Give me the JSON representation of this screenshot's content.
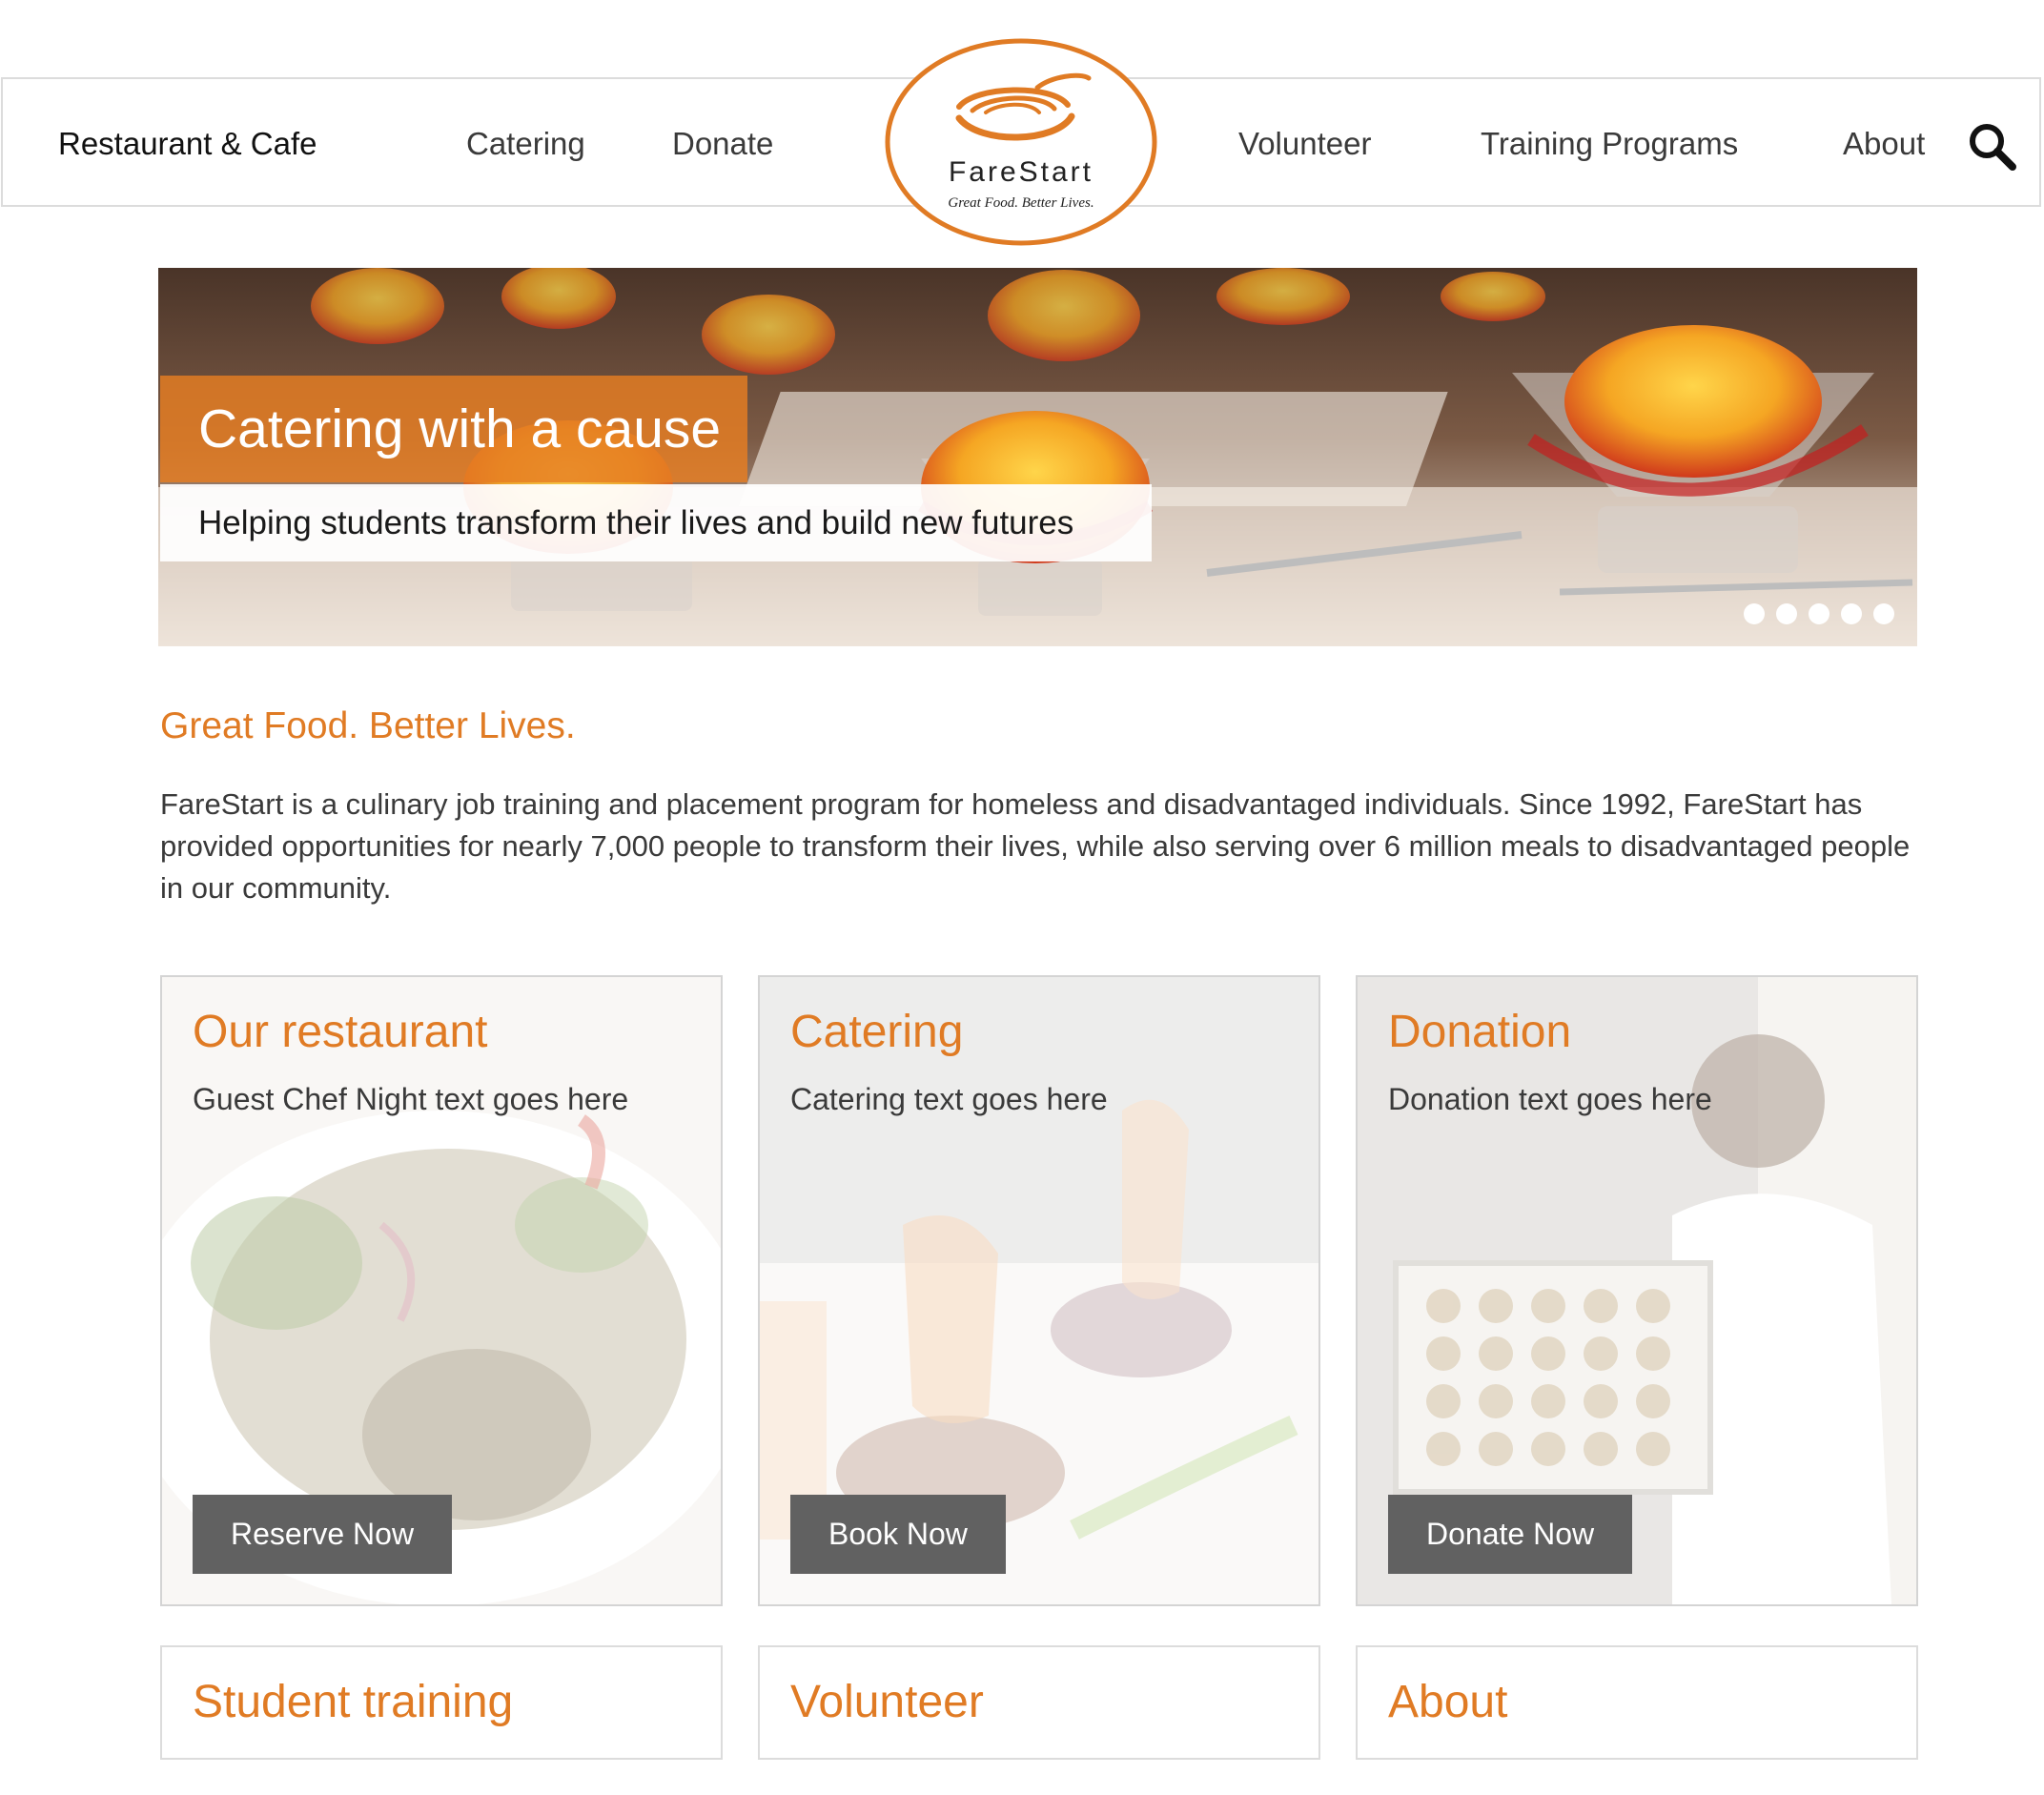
{
  "nav": {
    "items": [
      {
        "label": "Restaurant & Cafe"
      },
      {
        "label": "Catering"
      },
      {
        "label": "Donate"
      },
      {
        "label": "Volunteer"
      },
      {
        "label": "Training Programs"
      },
      {
        "label": "About"
      }
    ],
    "search_icon": "search-icon"
  },
  "logo": {
    "name": "FareStart",
    "tagline": "Great Food. Better Lives."
  },
  "hero": {
    "title": "Catering with a cause",
    "subtitle": "Helping students transform their lives and build new futures",
    "slide_count": 5,
    "active_slide": 1
  },
  "intro": {
    "tagline": "Great Food. Better Lives.",
    "paragraph": "FareStart is a culinary job training and placement program for homeless and disadvantaged individuals. Since 1992, FareStart has provided opportunities for nearly 7,000 people to transform their lives, while also serving over 6 million meals to disadvantaged people in our community."
  },
  "cards": [
    {
      "title": "Our restaurant",
      "text": "Guest Chef Night text goes here",
      "button": "Reserve Now"
    },
    {
      "title": "Catering",
      "text": "Catering text goes here",
      "button": "Book Now"
    },
    {
      "title": "Donation",
      "text": "Donation text goes here",
      "button": "Donate Now"
    }
  ],
  "tiles": [
    {
      "title": "Student training"
    },
    {
      "title": "Volunteer"
    },
    {
      "title": "About"
    }
  ],
  "colors": {
    "accent_orange": "#e07b24",
    "button_gray": "#616161",
    "border_gray": "#dcdcdc"
  }
}
